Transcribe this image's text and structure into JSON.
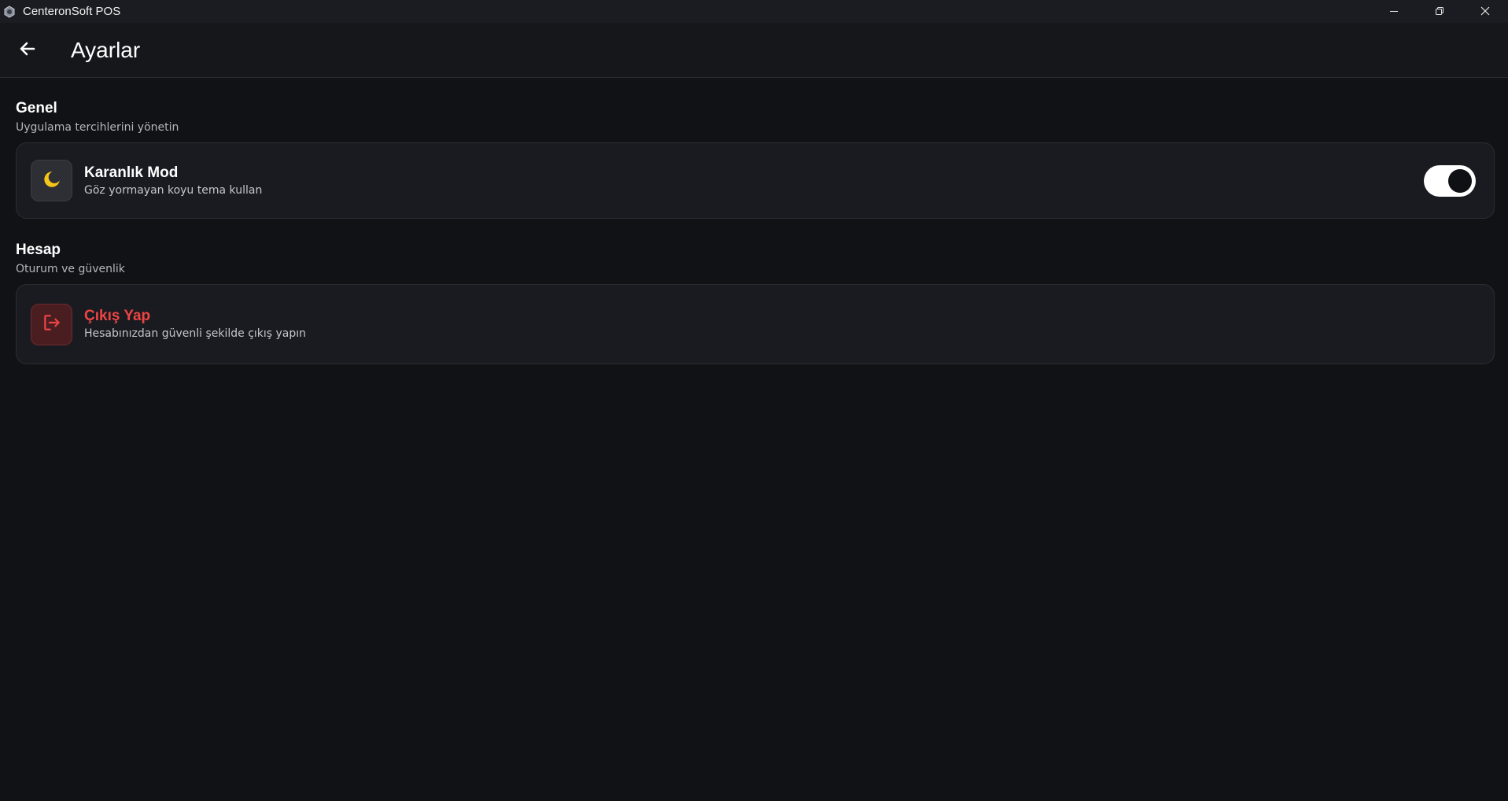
{
  "window": {
    "title": "CenteronSoft POS",
    "icon": "app-logo-icon",
    "controls": [
      "minimize-icon",
      "restore-icon",
      "close-icon"
    ]
  },
  "appbar": {
    "back_icon": "arrow-left-icon",
    "title": "Ayarlar"
  },
  "sections": {
    "general": {
      "title": "Genel",
      "subtitle": "Uygulama tercihlerini yönetin",
      "dark_mode": {
        "icon": "moon-icon",
        "title": "Karanlık Mod",
        "description": "Göz yormayan koyu tema kullan",
        "enabled": true
      }
    },
    "account": {
      "title": "Hesap",
      "subtitle": "Oturum ve güvenlik",
      "logout": {
        "icon": "logout-icon",
        "title": "Çıkış Yap",
        "description": "Hesabınızdan güvenli şekilde çıkış yapın"
      }
    }
  },
  "colors": {
    "background": "#111216",
    "card": "#1a1b20",
    "accent_moon": "#f5c518",
    "danger": "#ef4444",
    "toggle_track": "#ffffff"
  }
}
